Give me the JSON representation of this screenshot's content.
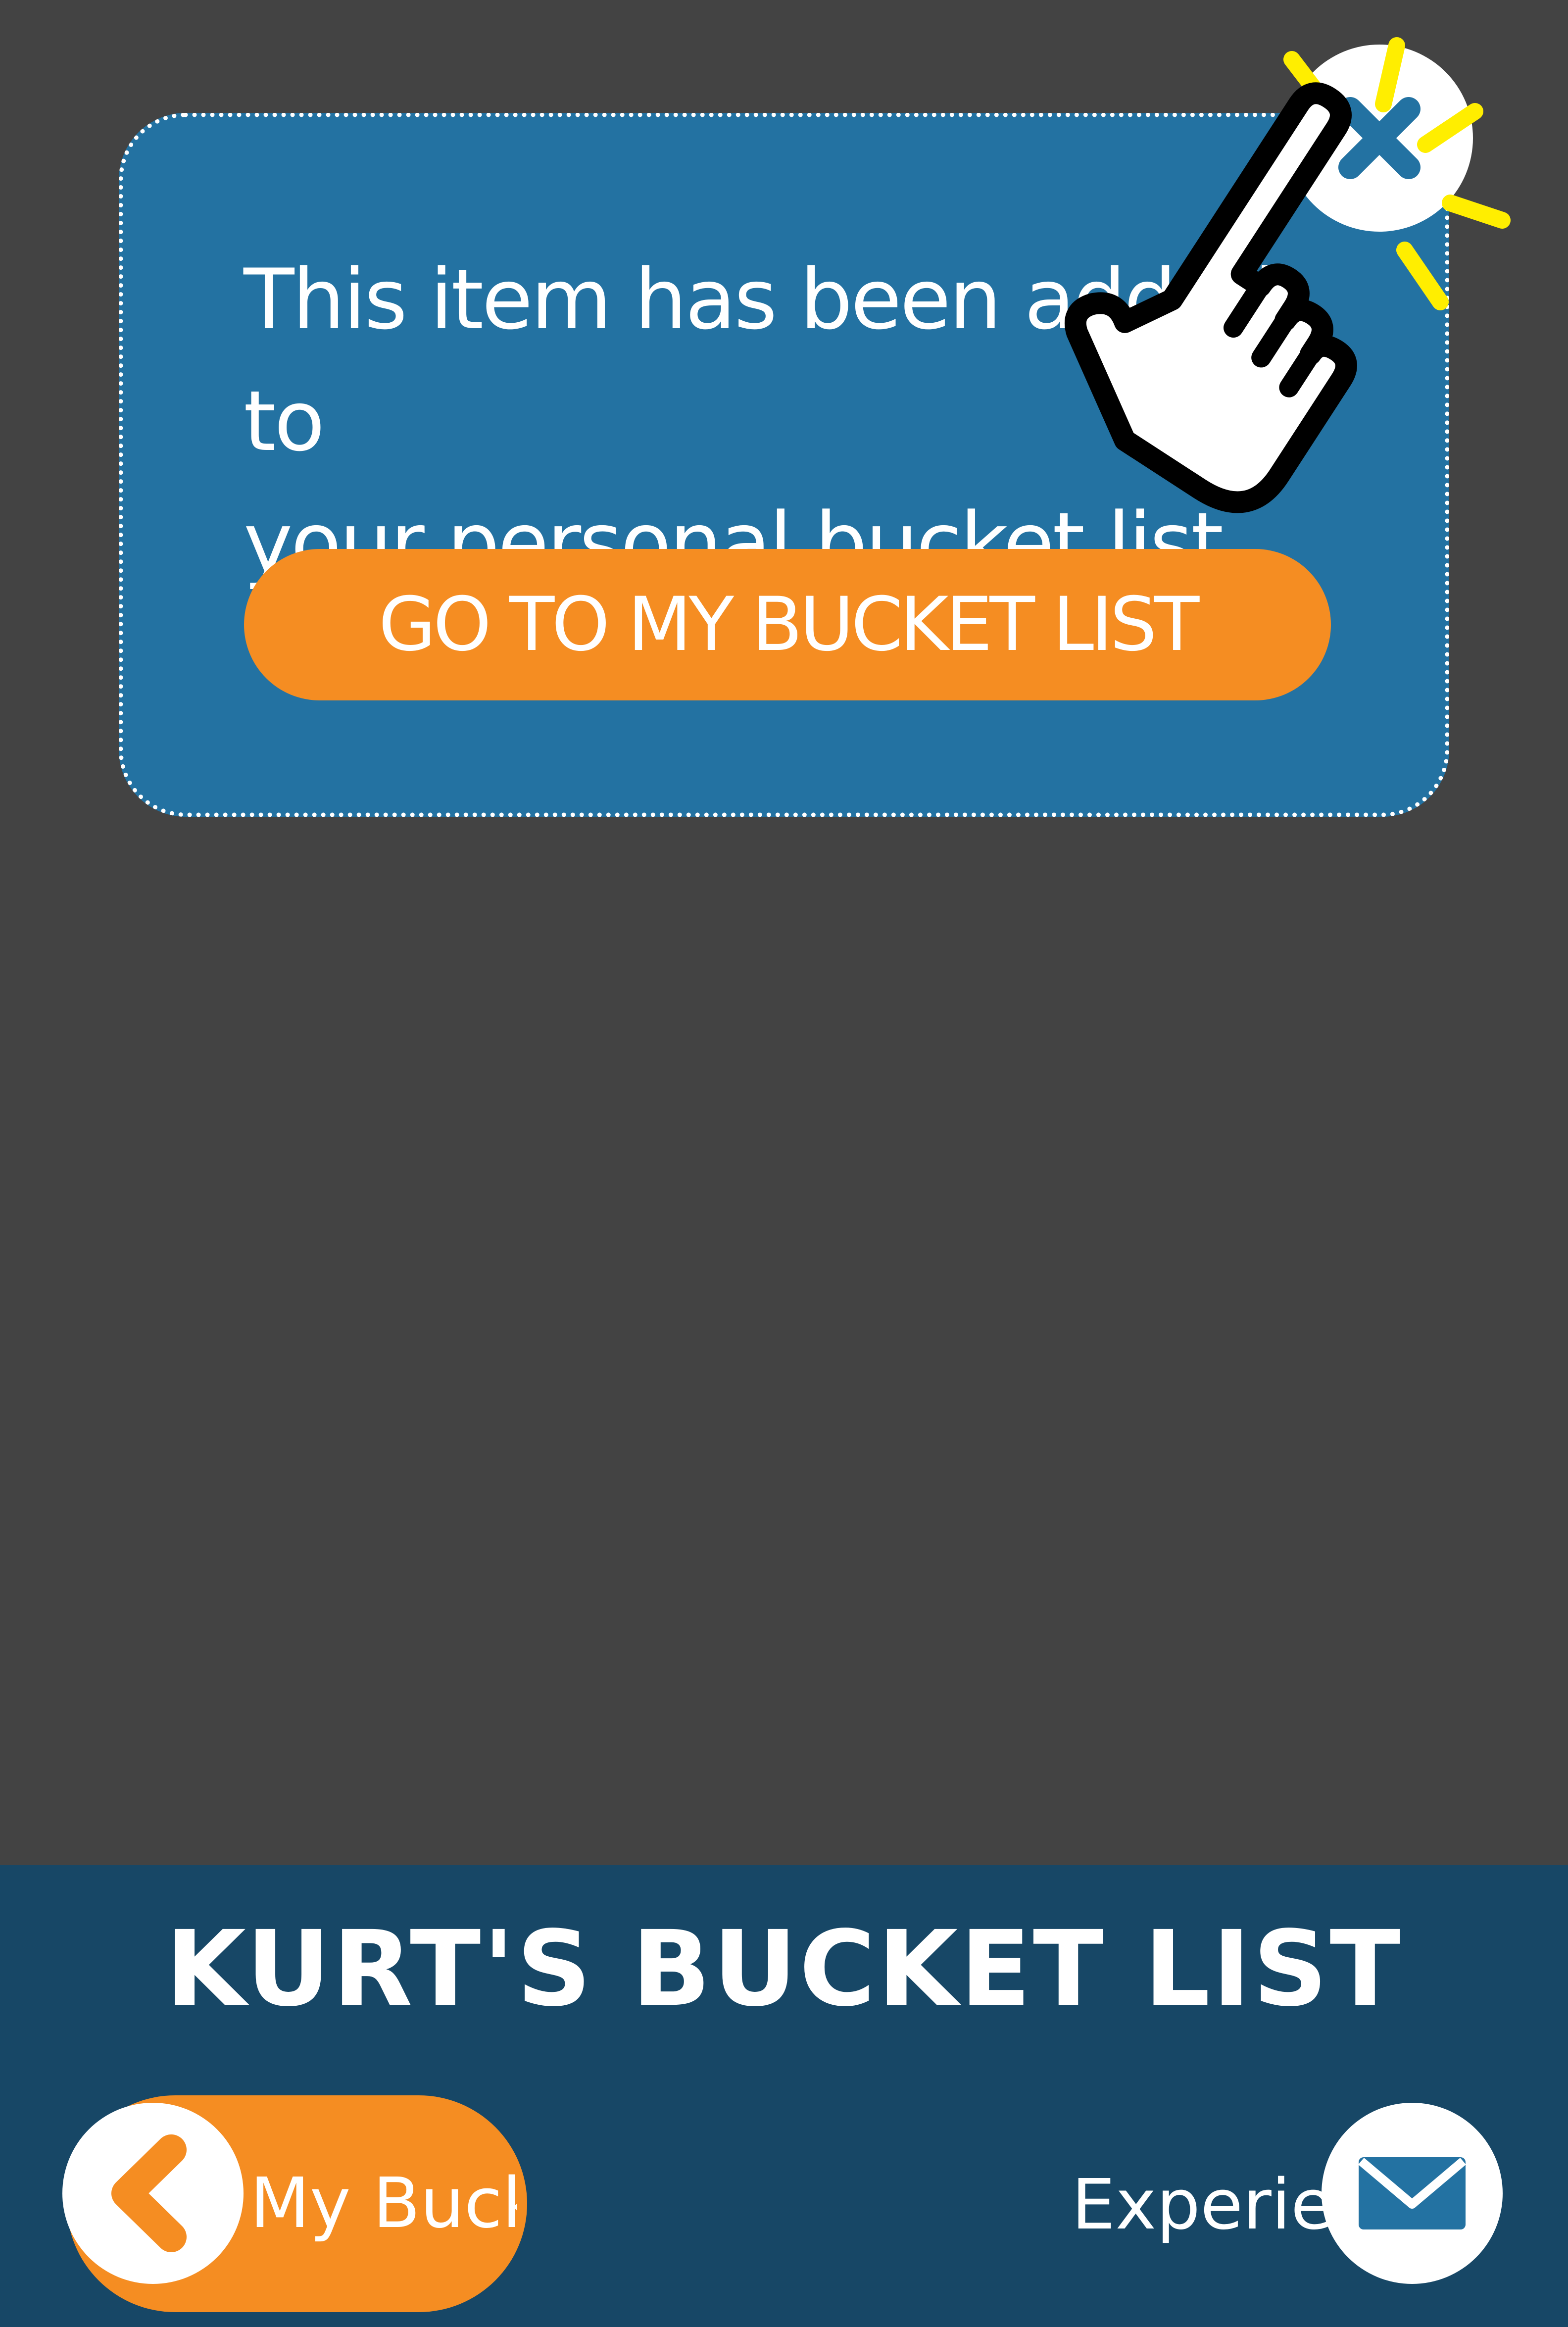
{
  "popup": {
    "message_line1": "This item has been added to",
    "message_line2": "your personal bucket list.",
    "button_label": "GO TO MY BUCKET LIST",
    "close_icon": "close-icon"
  },
  "tap_hint": {
    "icon": "pointing-hand-icon"
  },
  "bottom_bar": {
    "title": "KURT'S BUCKET LIST",
    "back_label": "My Bucket List",
    "back_icon": "chevron-left-icon",
    "experience_label": "Experience",
    "mail_icon": "mail-icon"
  },
  "colors": {
    "background": "#434343",
    "popup": "#2372a2",
    "accent_orange": "#f58d22",
    "bottom_bar": "#174766",
    "sparkle": "#ffee00"
  }
}
